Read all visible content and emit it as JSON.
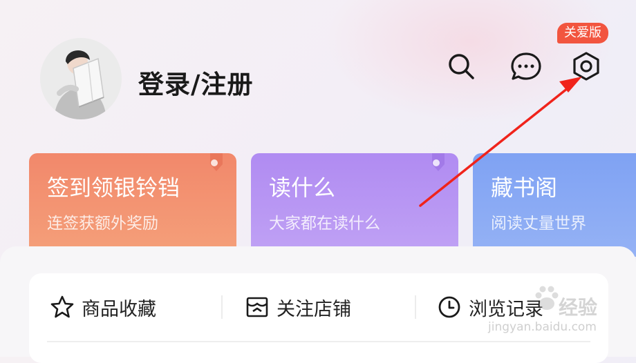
{
  "header": {
    "login_label": "登录/注册",
    "badge_label": "关爱版",
    "icons": [
      "search-icon",
      "message-icon",
      "settings-icon"
    ]
  },
  "cards": [
    {
      "title": "签到领银铃铛",
      "subtitle": "连签获额外奖励",
      "color": "#f2886b"
    },
    {
      "title": "读什么",
      "subtitle": "大家都在读什么",
      "color": "#b08bf2"
    },
    {
      "title": "藏书阁",
      "subtitle": "阅读丈量世界",
      "color": "#7fa2f3"
    }
  ],
  "shortcuts": [
    {
      "label": "商品收藏",
      "icon": "star-icon"
    },
    {
      "label": "关注店铺",
      "icon": "store-icon"
    },
    {
      "label": "浏览记录",
      "icon": "clock-icon"
    }
  ],
  "watermark": {
    "brand": "经验",
    "url": "jingyan.baidu.com"
  },
  "annotation": {
    "color": "#f0231b"
  }
}
